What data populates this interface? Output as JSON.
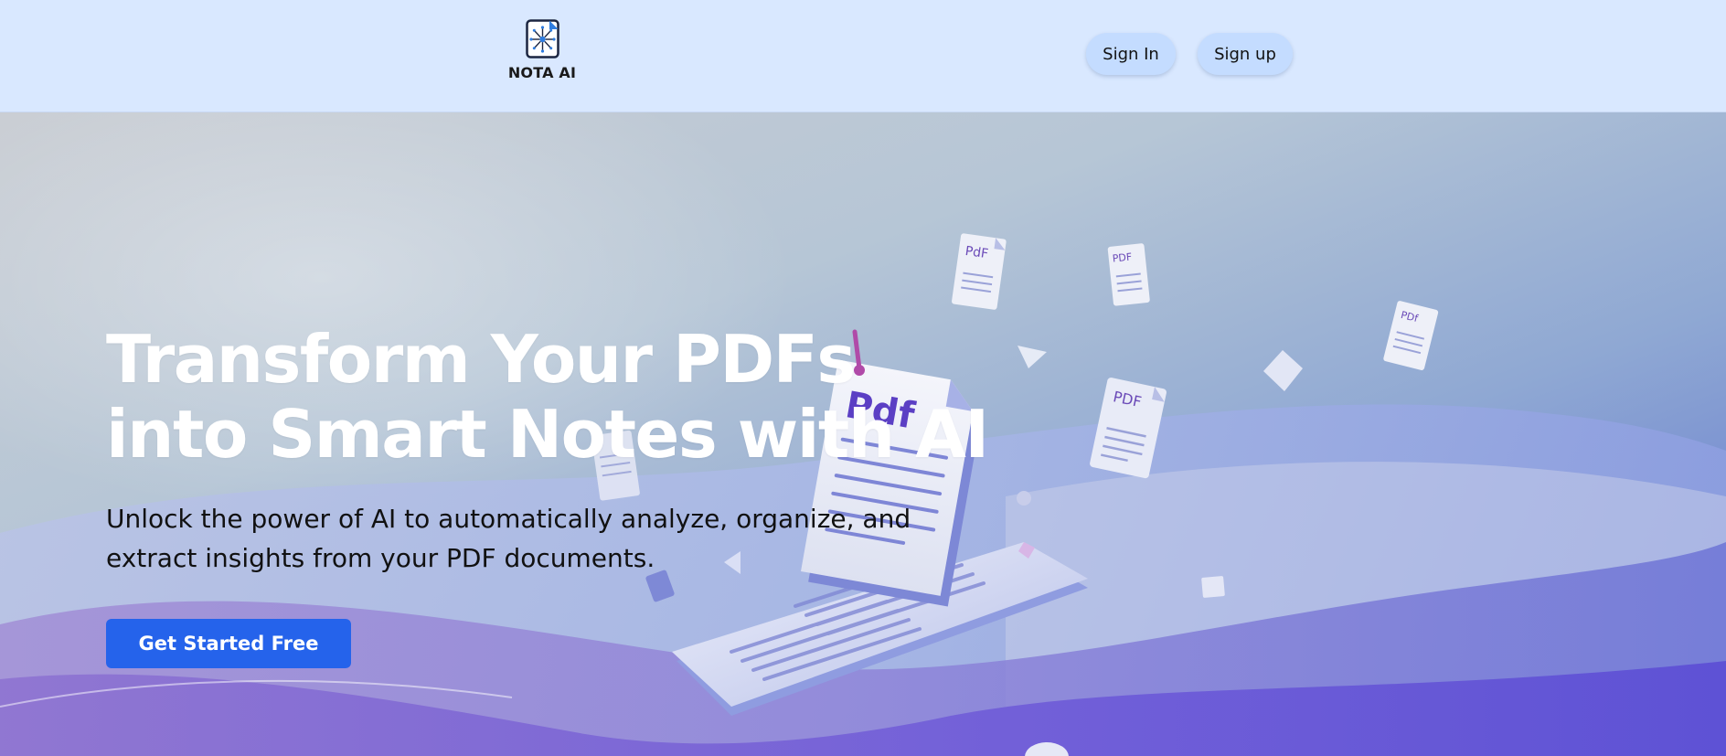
{
  "header": {
    "logo_text": "NOTA AI",
    "logo_icon": "circuit-document-icon",
    "sign_in_label": "Sign In",
    "sign_up_label": "Sign up"
  },
  "hero": {
    "title_line1": "Transform Your PDFs",
    "title_line2": "into Smart Notes with AI",
    "subtitle_line1": "Unlock the power of AI to automatically analyze, organize, and",
    "subtitle_line2": "extract insights from your PDF documents.",
    "cta_label": "Get Started Free",
    "illustration": "floating-pdf-documents-illustration",
    "doc_label": "PDF"
  },
  "colors": {
    "header_bg": "#d9e8ff",
    "nav_button_bg": "#c4dcff",
    "cta_bg": "#2563eb",
    "title_text": "#ffffff",
    "body_text": "#111111",
    "accent_purple": "#5b3fc4"
  }
}
